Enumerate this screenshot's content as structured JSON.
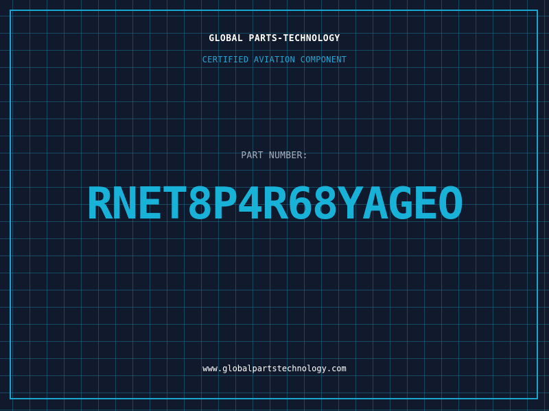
{
  "company_name": "GLOBAL PARTS-TECHNOLOGY",
  "tagline": "CERTIFIED AVIATION COMPONENT",
  "part_label": "PART NUMBER:",
  "part_number": "RNET8P4R68YAGEO",
  "website": "www.globalpartstechnology.com",
  "colors": {
    "background": "#111a2c",
    "grid": "#1a6e8c",
    "frame": "#1aa7cf",
    "accent": "#18b2d9",
    "label": "#a6b0bd",
    "text": "#ffffff"
  }
}
